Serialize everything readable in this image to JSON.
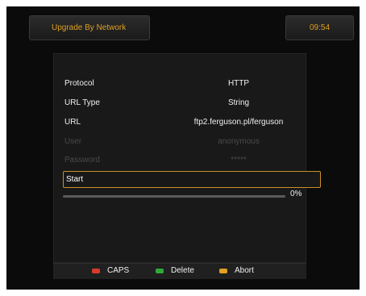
{
  "header": {
    "title": "Upgrade By Network",
    "clock": "09:54"
  },
  "form": {
    "rows": [
      {
        "label": "Protocol",
        "value": "HTTP"
      },
      {
        "label": "URL Type",
        "value": "String"
      },
      {
        "label": "URL",
        "value": "ftp2.ferguson.pl/ferguson"
      },
      {
        "label": "User",
        "value": "anonymous",
        "disabled": true
      },
      {
        "label": "Password",
        "value": "*****",
        "disabled": true
      }
    ],
    "start_label": "Start"
  },
  "progress": {
    "percent_text": "0%",
    "value": 0
  },
  "footer": {
    "actions": [
      {
        "label": "CAPS",
        "color": "#d83a2a"
      },
      {
        "label": "Delete",
        "color": "#2fa83a"
      },
      {
        "label": "Abort",
        "color": "#e0a020"
      }
    ]
  },
  "colors": {
    "accent": "#e0a020",
    "highlight_border": "#c8902a",
    "disabled_text": "#4a4a4a"
  }
}
